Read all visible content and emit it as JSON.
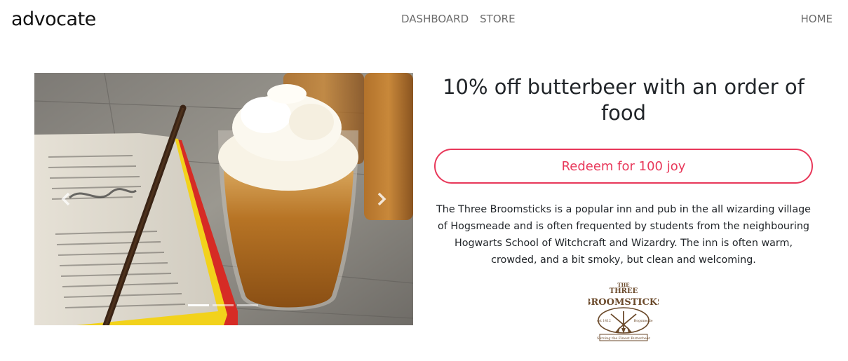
{
  "nav": {
    "brand": "advocate",
    "links": [
      "DASHBOARD",
      "STORE"
    ],
    "right_link": "HOME"
  },
  "carousel": {
    "slides": 3,
    "active_index": 0
  },
  "offer": {
    "title": "10% off butterbeer with an order of food",
    "redeem_label": "Redeem for 100 joy",
    "description": "The Three Broomsticks is a popular inn and pub in the all wizarding village of Hogsmeade and is often frequented by students from the neighbouring Hogwarts School of Witchcraft and Wizardry. The inn is often warm, crowded, and a bit smoky, but clean and welcoming."
  },
  "logo": {
    "line1": "THE",
    "line2": "THREE",
    "line3": "BROOMSTICKS",
    "est": "est 1412",
    "place": "Hogsmeade",
    "tagline": "Serving the Finest Butterbeer"
  },
  "colors": {
    "accent": "#e8385a",
    "nav_text": "#6d6d6d",
    "logo_brown": "#6b4a2b"
  }
}
